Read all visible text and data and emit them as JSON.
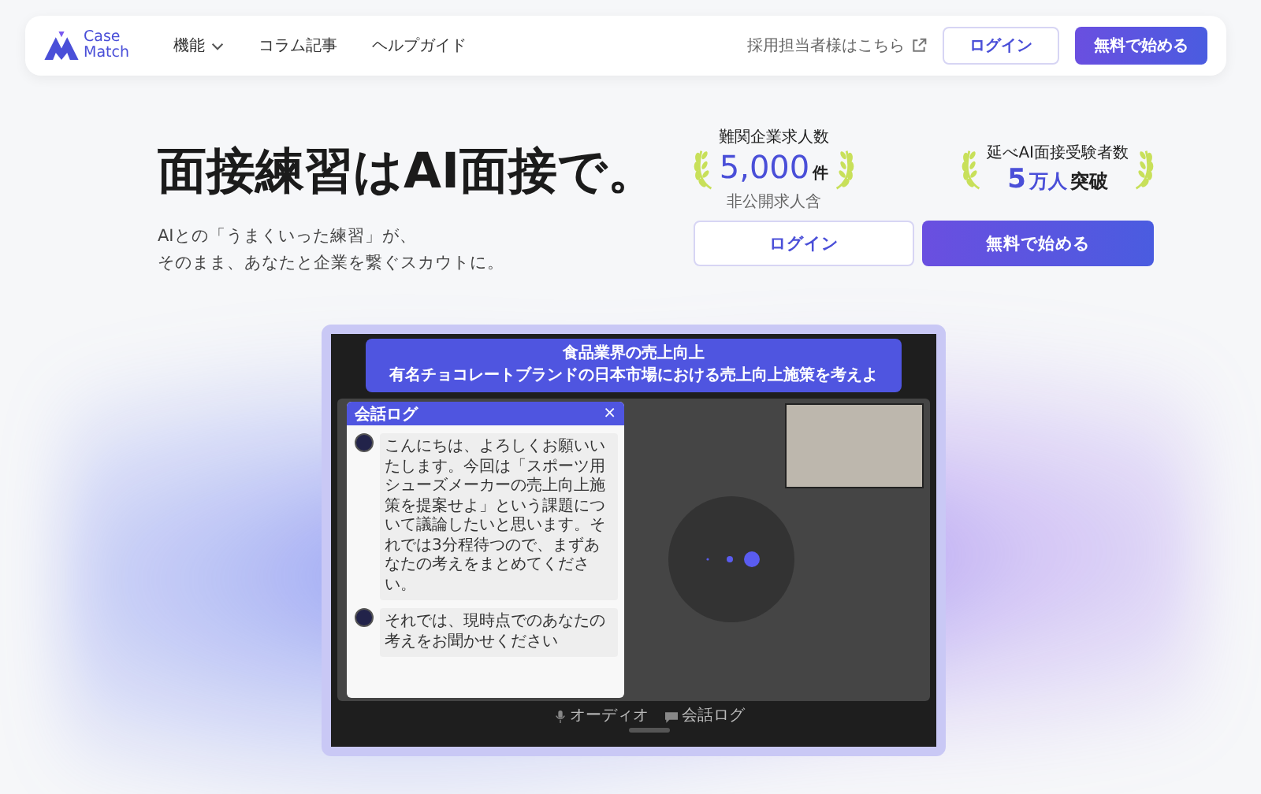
{
  "header": {
    "logo_lines": [
      "Case",
      "Match"
    ],
    "nav": [
      {
        "label": "機能",
        "dropdown": true
      },
      {
        "label": "コラム記事",
        "dropdown": false
      },
      {
        "label": "ヘルプガイド",
        "dropdown": false
      }
    ],
    "recruiter_link": "採用担当者様はこちら",
    "login": "ログイン",
    "signup": "無料で始める"
  },
  "hero": {
    "heading": "面接練習は**AI面接**で。",
    "subtext": [
      "AIとの「うまくいった練習」が、",
      "そのまま、あなたと企業を繋ぐスカウトに。"
    ],
    "stats": [
      {
        "label": "難関企業求人数",
        "value": "5,000",
        "unit": "件",
        "note": "非公開求人含"
      },
      {
        "label": "延べAI面接受験者数",
        "value": "5",
        "unit": "万人",
        "suffix": "突破"
      }
    ],
    "login": "ログイン",
    "signup": "無料で始める"
  },
  "demo": {
    "category": "食品業界の売上向上",
    "title": "有名チョコレートブランドの日本市場における売上向上施策を考えよ",
    "chat_title": "会話ログ",
    "close": "×",
    "messages": [
      "こんにちは、よろしくお願いいたします。今回は「スポーツ用シューズメーカーの売上向上施策を提案せよ」という課題について議論したいと思います。それでは3分程待つので、まずあなたの考えをまとめてください。",
      "それでは、現時点でのあなたの考えをお聞かせください"
    ],
    "controls": [
      {
        "kind": "mic",
        "label": "オーディオ"
      },
      {
        "kind": "chat",
        "label": "会話ログ"
      }
    ]
  }
}
